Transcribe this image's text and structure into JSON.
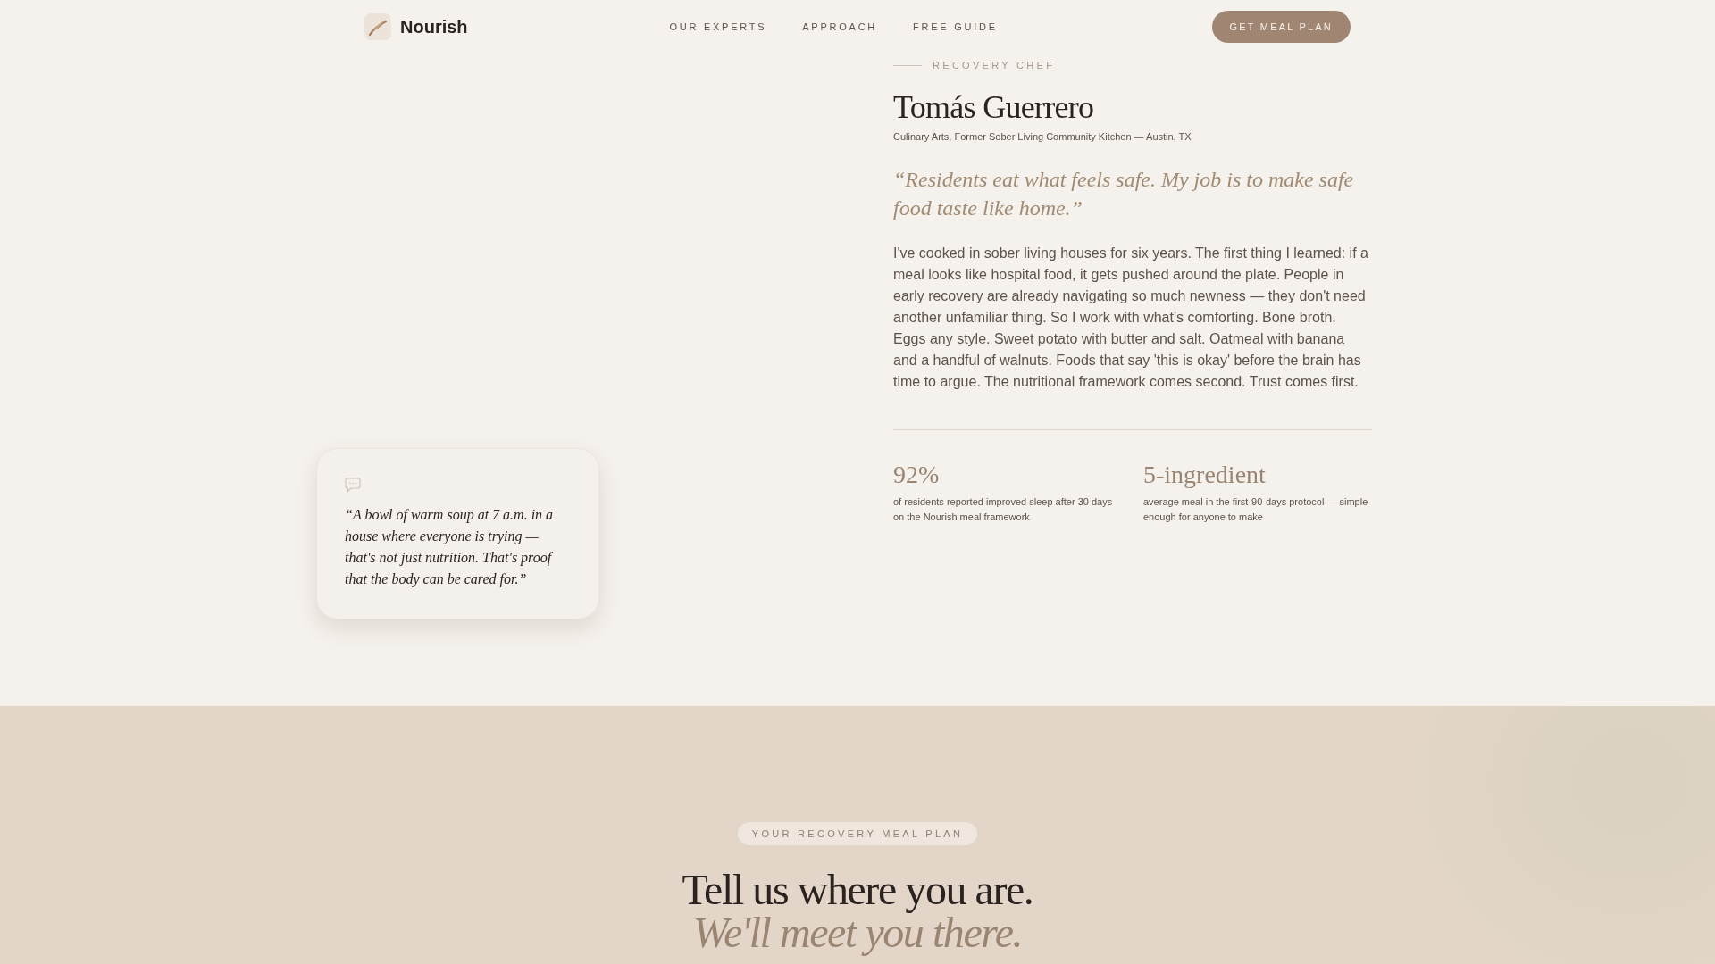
{
  "header": {
    "brand": "Nourish",
    "nav": [
      "OUR EXPERTS",
      "APPROACH",
      "FREE GUIDE"
    ],
    "cta": "GET MEAL PLAN"
  },
  "expert": {
    "eyebrow": "RECOVERY CHEF",
    "name": "Tomás Guerrero",
    "credentials": "Culinary Arts, Former Sober Living Community Kitchen — Austin, TX",
    "quote": "“Residents eat what feels safe. My job is to make safe food taste like home.”",
    "bio": "I've cooked in sober living houses for six years. The first thing I learned: if a meal looks like hospital food, it gets pushed around the plate. People in early recovery are already navigating so much newness — they don't need another unfamiliar thing. So I work with what's comforting. Bone broth. Eggs any style. Sweet potato with butter and salt. Oatmeal with banana and a handful of walnuts. Foods that say 'this is okay' before the brain has time to argue. The nutritional framework comes second. Trust comes first.",
    "stats": [
      {
        "value": "92%",
        "description": "of residents reported improved sleep after 30 days on the Nourish meal framework"
      },
      {
        "value": "5-ingredient",
        "description": "average meal in the first-90-days protocol — simple enough for anyone to make"
      }
    ]
  },
  "quote_card": {
    "quote": "“A bowl of warm soup at 7 a.m. in a house where everyone is trying — that's not just nutrition. That's proof that the body can be cared for.”"
  },
  "meal_plan": {
    "badge": "YOUR RECOVERY MEAL PLAN",
    "heading": "Tell us where you are.",
    "subheading": "We'll meet you there."
  }
}
